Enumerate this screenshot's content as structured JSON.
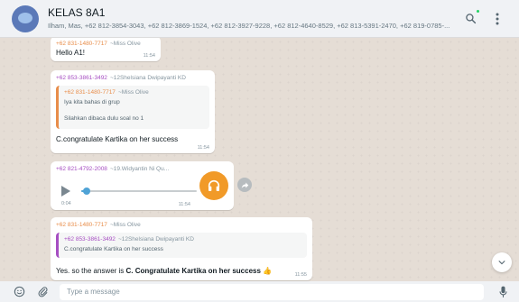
{
  "header": {
    "title": "KELAS 8A1",
    "members": "Ilham, Mas, +62 812-3854-3043, +62 812-3869-1524, +62 812-3927-9228, +62 812-4640-8529, +62 813-5391-2470, +62 819-0785-..."
  },
  "messages": [
    {
      "sender_number": "+62 831-1480-7717",
      "sender_name": "~Miss Olive",
      "text": "Hello A1!",
      "time": "11:54"
    },
    {
      "sender_number": "+62 853-3861-3492",
      "sender_name": "~12Shelsiana Dwipayanti KD",
      "quote": {
        "sender_number": "+62 831-1480-7717",
        "sender_name": "~Miss Olive",
        "line1": "Iya kita bahas di grup",
        "line2": "Silahkan dibaca dulu soal no 1"
      },
      "text": "C.congratulate Kartika on her success",
      "time": "11:54"
    },
    {
      "sender_number": "+62 821-4792-2008",
      "sender_name": "~19.Widyantin Ni Qu...",
      "voice": {
        "duration": "0:04",
        "progress": 0.05
      },
      "time": "11:54"
    },
    {
      "sender_number": "+62 831-1480-7717",
      "sender_name": "~Miss Olive",
      "quote": {
        "sender_number": "+62 853-3861-3492",
        "sender_name": "~12Shelsiana Dwipayanti KD",
        "line1": "C.congratulate Kartika on her success"
      },
      "text_prefix": "Yes. so the answer is ",
      "text_bold": "C. Congratulate Kartika on her success",
      "emoji": "👍",
      "time": "11:55"
    }
  ],
  "composer": {
    "placeholder": "Type a message"
  },
  "icons": [
    "search-icon",
    "menu-icon",
    "play-icon",
    "headphones-icon",
    "forward-icon",
    "chevron-down-icon",
    "emoji-icon",
    "attach-icon",
    "mic-icon"
  ],
  "colors": {
    "accent": "#f19a28",
    "sender_orange": "#e88d4a",
    "sender_purple": "#a64ec2",
    "voice_blue": "#4fa3d6"
  }
}
